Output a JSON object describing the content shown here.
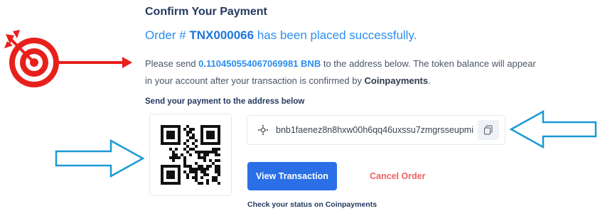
{
  "confirm": {
    "title": "Confirm Your Payment",
    "order_prefix": "Order # ",
    "order_id": "TNX000066",
    "order_suffix": " has been placed successfully.",
    "para_part1": "Please send ",
    "amount": "0.110450554067069981 BNB",
    "para_part2": " to the address below. The token balance will appear in your account after your transaction is confirmed by ",
    "provider": "Coinpayments",
    "para_end": "."
  },
  "payment": {
    "send_label": "Send your payment to the address below",
    "address": "bnb1faenez8n8hxw00h6qq46uxssu7zmgrsseupmi",
    "coin_icon": "bnb-icon",
    "copy_icon": "copy-icon"
  },
  "actions": {
    "view_transaction": "View Transaction",
    "cancel_order": "Cancel Order",
    "status_link": "Check your status on Coinpayments"
  },
  "annotations": {
    "target_color": "#e8201c",
    "arrow_left_color": "#e8201c",
    "outline_arrow_color": "#1a9ad6"
  }
}
